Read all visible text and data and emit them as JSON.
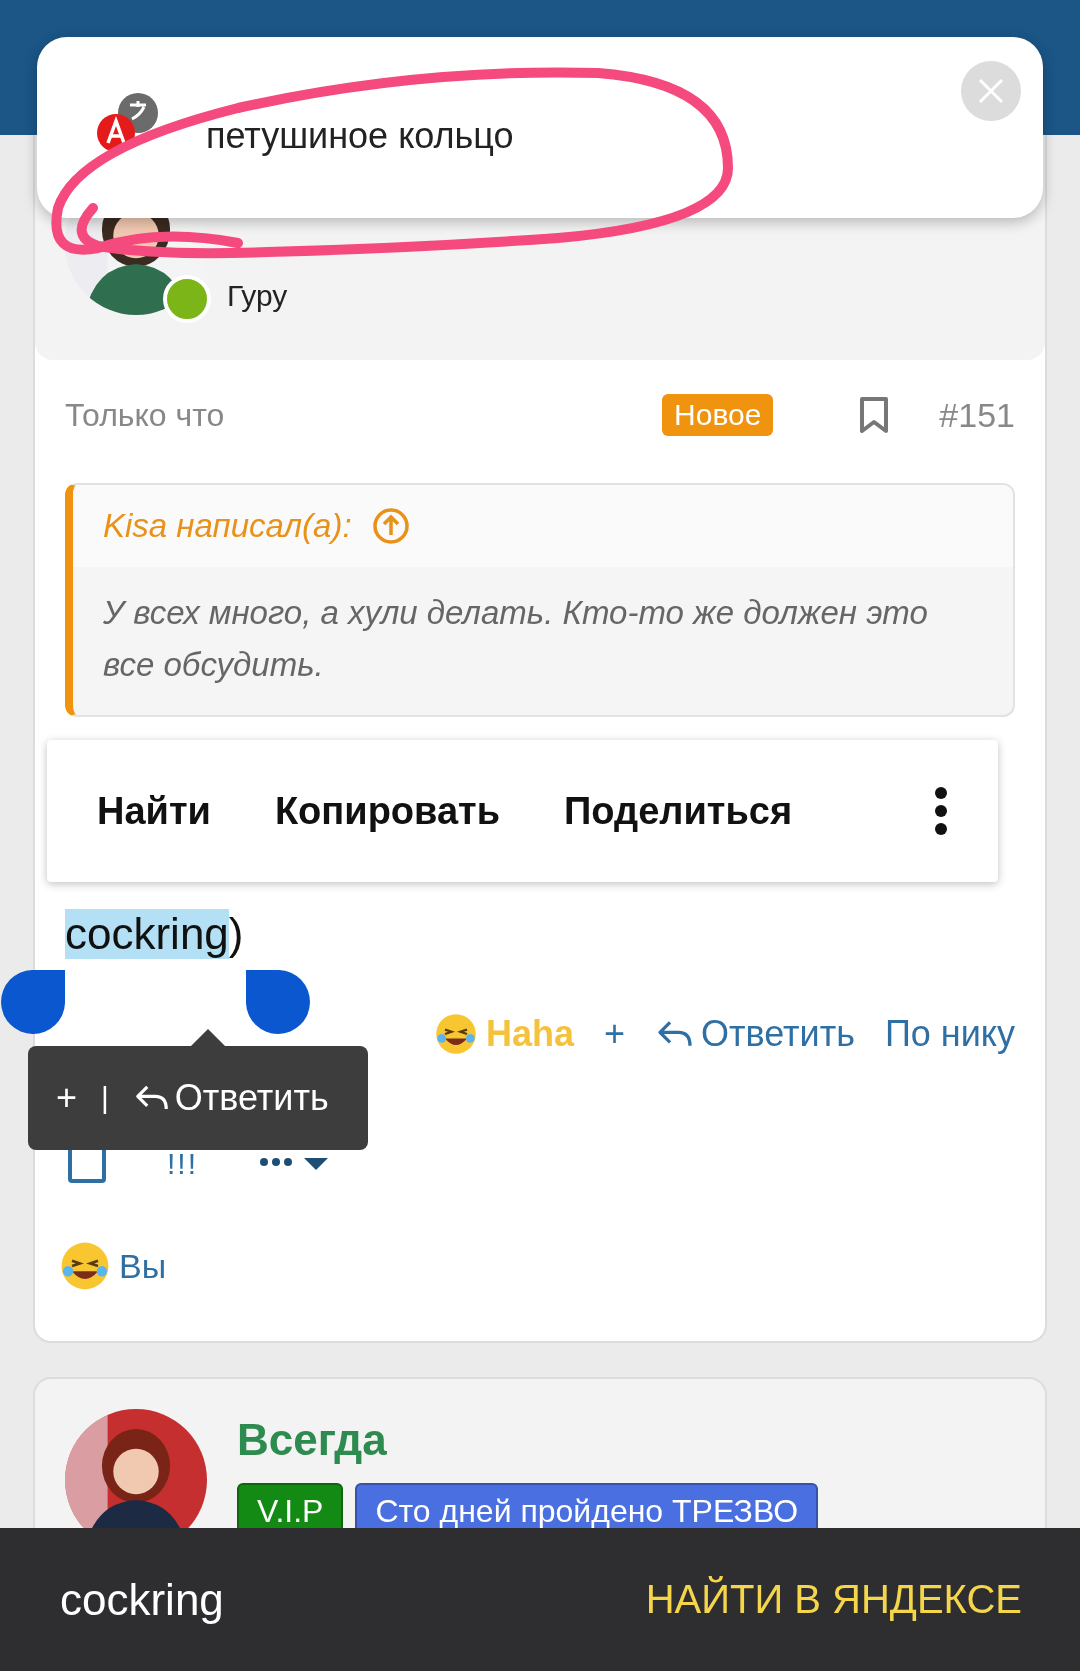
{
  "translation_popup": {
    "text": "петушиное кольцо"
  },
  "post": {
    "author_rank": "Гуру",
    "time": "Только что",
    "badge": "Новое",
    "number": "#151",
    "quote": {
      "author": "Kisa написал(а):",
      "text": "У всех много, а хули делать. Кто-то же должен это все обсудить."
    },
    "body": {
      "selected_word": "cockring",
      "rest": " )"
    },
    "reactions": {
      "reaction": "Haha",
      "add": "+",
      "reply": "Ответить",
      "by_nick": "По нику"
    },
    "tools": {
      "flag": "!!!"
    },
    "reacted": {
      "who": "Вы"
    }
  },
  "context_menu": {
    "items": [
      "Найти",
      "Копировать",
      "Поделиться"
    ]
  },
  "selection_tooltip": {
    "add": "+",
    "separator": "|",
    "reply": "Ответить"
  },
  "next_post": {
    "author": "Всегда",
    "badges": [
      {
        "label": "V.I.P",
        "color": "#138a13"
      },
      {
        "label": "Сто дней пройдено ТРЕЗВО",
        "color": "#4a6fe0"
      }
    ]
  },
  "search_bar": {
    "query": "cockring",
    "action": "НАЙТИ В ЯНДЕКСЕ"
  }
}
